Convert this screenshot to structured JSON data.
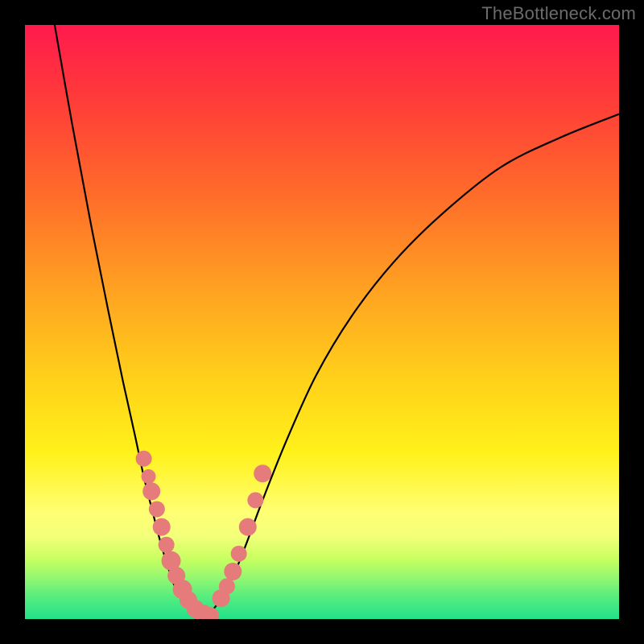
{
  "watermark": "TheBottleneck.com",
  "colors": {
    "gradient_top": "#ff1a4d",
    "gradient_bottom": "#22e18a",
    "curve": "#000000",
    "marker_fill": "#e57b7b",
    "marker_stroke": "#cf6b6b"
  },
  "chart_data": {
    "type": "line",
    "title": "",
    "xlabel": "",
    "ylabel": "",
    "xlim": [
      0,
      1
    ],
    "ylim": [
      0,
      1
    ],
    "left_curve": {
      "x": [
        0.05,
        0.08,
        0.11,
        0.14,
        0.165,
        0.185,
        0.2,
        0.215,
        0.228,
        0.24,
        0.252,
        0.265,
        0.28,
        0.3
      ],
      "y": [
        1.0,
        0.83,
        0.67,
        0.52,
        0.4,
        0.31,
        0.24,
        0.18,
        0.13,
        0.09,
        0.055,
        0.03,
        0.012,
        0.003
      ]
    },
    "right_curve": {
      "x": [
        0.3,
        0.32,
        0.345,
        0.37,
        0.4,
        0.44,
        0.49,
        0.55,
        0.62,
        0.7,
        0.8,
        0.9,
        1.0
      ],
      "y": [
        0.003,
        0.02,
        0.06,
        0.12,
        0.2,
        0.3,
        0.41,
        0.51,
        0.6,
        0.68,
        0.76,
        0.81,
        0.85
      ]
    },
    "left_markers": {
      "x": [
        0.2,
        0.208,
        0.213,
        0.222,
        0.23,
        0.238,
        0.246,
        0.255,
        0.265,
        0.275,
        0.287,
        0.3,
        0.312
      ],
      "y": [
        0.27,
        0.24,
        0.215,
        0.185,
        0.155,
        0.125,
        0.098,
        0.073,
        0.05,
        0.032,
        0.017,
        0.008,
        0.005
      ],
      "r": [
        10,
        9,
        11,
        10,
        11,
        10,
        12,
        11,
        12,
        11,
        11,
        12,
        11
      ]
    },
    "right_markers": {
      "x": [
        0.33,
        0.34,
        0.35,
        0.36,
        0.375,
        0.388,
        0.4
      ],
      "y": [
        0.035,
        0.055,
        0.08,
        0.11,
        0.155,
        0.2,
        0.245
      ],
      "r": [
        11,
        10,
        11,
        10,
        11,
        10,
        11
      ]
    }
  }
}
